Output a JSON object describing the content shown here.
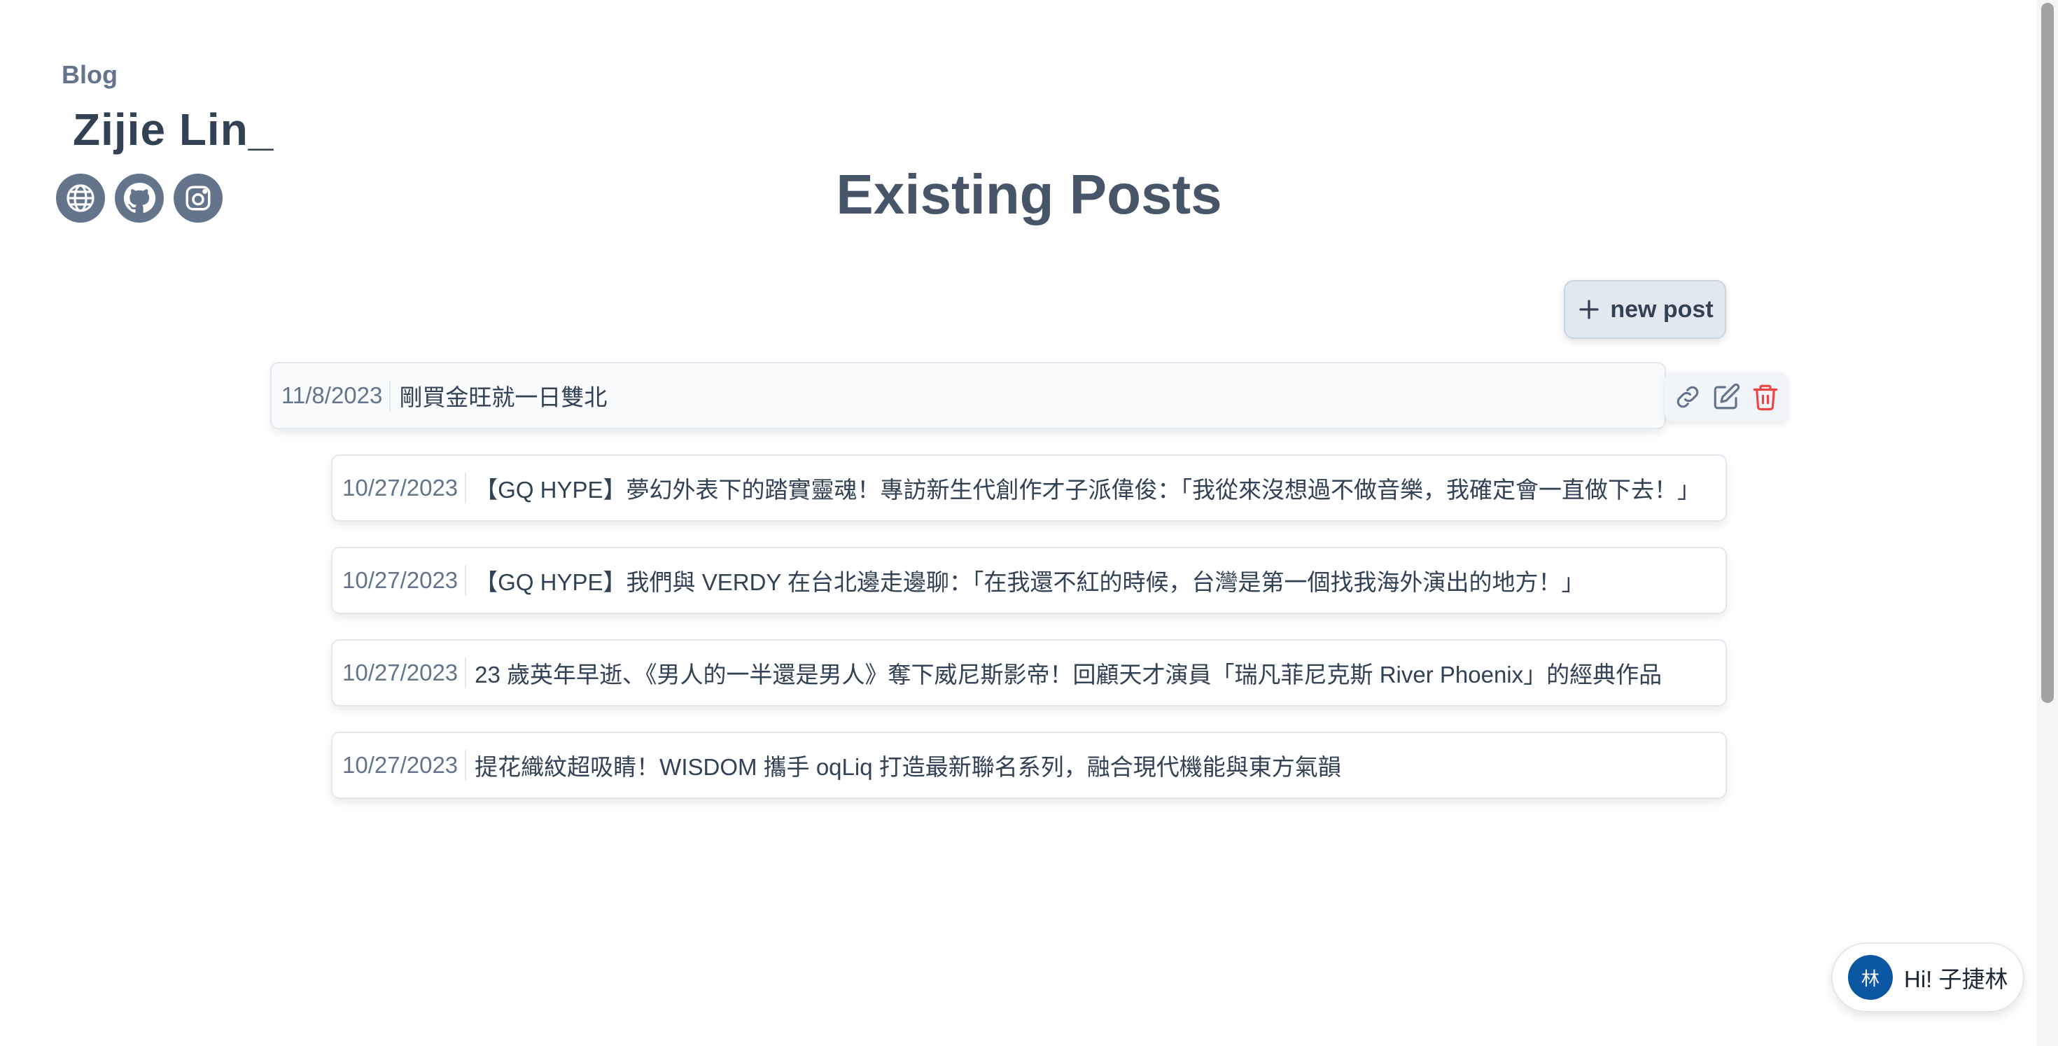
{
  "brand": {
    "label": "Blog",
    "name": "Zijie Lin_"
  },
  "social": [
    {
      "icon": "globe-icon"
    },
    {
      "icon": "github-icon"
    },
    {
      "icon": "instagram-icon"
    }
  ],
  "page": {
    "title": "Existing Posts"
  },
  "toolbar": {
    "new_post_label": "new post",
    "new_post_icon": "plus-icon"
  },
  "posts": [
    {
      "date": "11/8/2023",
      "title": "剛買金旺就一日雙北",
      "active": true
    },
    {
      "date": "10/27/2023",
      "title": "【GQ HYPE】夢幻外表下的踏實靈魂！專訪新生代創作才子派偉俊：「我從來沒想過不做音樂，我確定會一直做下去！」"
    },
    {
      "date": "10/27/2023",
      "title": "【GQ HYPE】我們與 VERDY 在台北邊走邊聊：「在我還不紅的時候，台灣是第一個找我海外演出的地方！」"
    },
    {
      "date": "10/27/2023",
      "title": "23 歲英年早逝、《男人的一半還是男人》奪下威尼斯影帝！回顧天才演員「瑞凡菲尼克斯 River Phoenix」的經典作品"
    },
    {
      "date": "10/27/2023",
      "title": "提花織紋超吸睛！WISDOM 攜手 oqLiq 打造最新聯名系列，融合現代機能與東方氣韻"
    }
  ],
  "post_actions": [
    {
      "icon": "link-icon"
    },
    {
      "icon": "edit-icon"
    },
    {
      "icon": "trash-icon",
      "color": "#ef4444"
    }
  ],
  "greeting": {
    "avatar_text": "林",
    "text": "Hi! 子捷林"
  },
  "colors": {
    "avatar_bg": "#0b57a4",
    "accent": "#475569",
    "danger": "#ef4444"
  }
}
